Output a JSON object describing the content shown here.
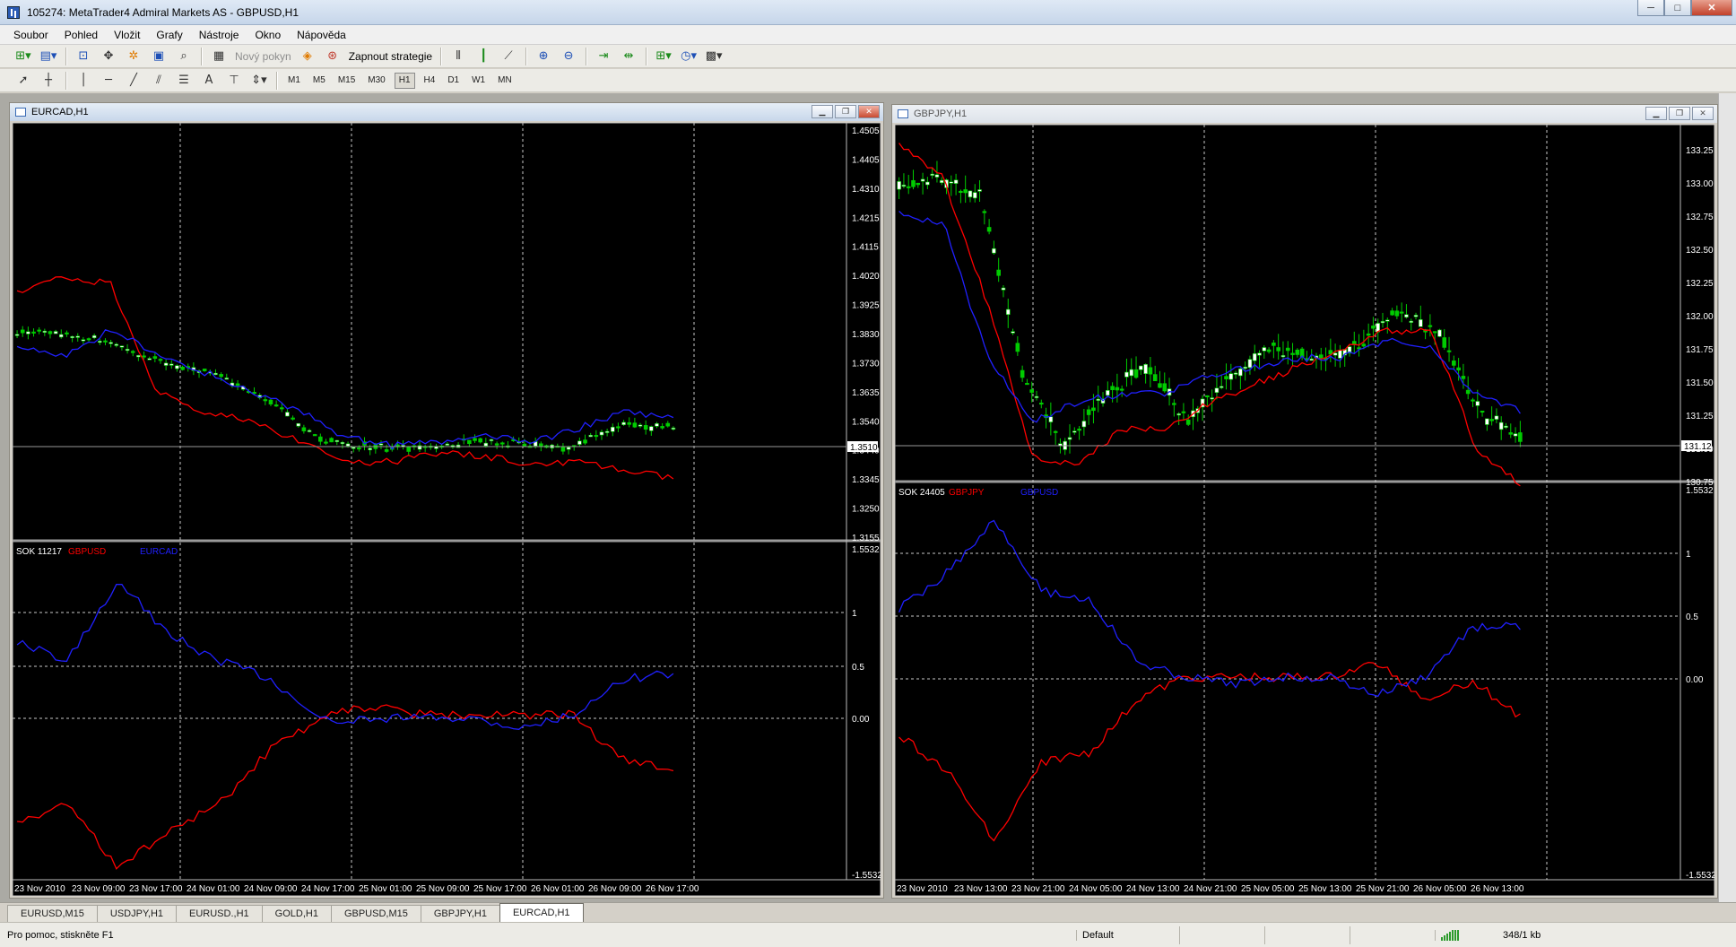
{
  "window": {
    "title": "105274: MetaTrader4 Admiral Markets AS - GBPUSD,H1",
    "buttons": [
      "─",
      "□",
      "✕"
    ]
  },
  "menu": [
    "Soubor",
    "Pohled",
    "Vložit",
    "Grafy",
    "Nástroje",
    "Okno",
    "Nápověda"
  ],
  "toolbar1": {
    "new_order": "Nový pokyn",
    "strategy": "Zapnout strategie"
  },
  "toolbar2": {
    "timeframes": [
      "M1",
      "M5",
      "M15",
      "M30",
      "H1",
      "H4",
      "D1",
      "W1",
      "MN"
    ],
    "active_timeframe": "H1"
  },
  "colors": {
    "background": "#000000",
    "grid": "#c8c8c8",
    "bull_candle": "#00cc00",
    "bear_candle": "#ffffff",
    "line_red": "#ff0000",
    "line_blue": "#2020ff",
    "text": "#ffffff"
  },
  "charts": [
    {
      "title": "EURCAD,H1",
      "price_axis": [
        "1.4505",
        "1.4405",
        "1.4310",
        "1.4215",
        "1.4115",
        "1.4020",
        "1.3925",
        "1.3830",
        "1.3730",
        "1.3635",
        "1.3540",
        "1.3440",
        "1.3345",
        "1.3250",
        "1.3155"
      ],
      "current_price": "1.3510",
      "indicator_label": "SOK 11217",
      "indicator_legend": [
        "GBPUSD",
        "EURCAD"
      ],
      "indicator_axis": [
        "1.5532",
        "1",
        "0.5",
        "0.00",
        "-1.5532"
      ],
      "time_axis": [
        "23 Nov 2010",
        "23 Nov 09:00",
        "23 Nov 17:00",
        "24 Nov 01:00",
        "24 Nov 09:00",
        "24 Nov 17:00",
        "25 Nov 01:00",
        "25 Nov 09:00",
        "25 Nov 17:00",
        "26 Nov 01:00",
        "26 Nov 09:00",
        "26 Nov 17:00"
      ]
    },
    {
      "title": "GBPJPY,H1",
      "price_axis": [
        "133.25",
        "133.00",
        "132.75",
        "132.50",
        "132.25",
        "132.00",
        "131.75",
        "131.50",
        "131.25",
        "131.00",
        "130.75"
      ],
      "current_price": "131.12",
      "indicator_label": "SOK 24405",
      "indicator_legend": [
        "GBPJPY",
        "GBPUSD"
      ],
      "indicator_axis": [
        "1.5532",
        "1",
        "0.5",
        "0.00",
        "-1.5532"
      ],
      "time_axis": [
        "23 Nov 2010",
        "23 Nov 13:00",
        "23 Nov 21:00",
        "24 Nov 05:00",
        "24 Nov 13:00",
        "24 Nov 21:00",
        "25 Nov 05:00",
        "25 Nov 13:00",
        "25 Nov 21:00",
        "26 Nov 05:00",
        "26 Nov 13:00"
      ]
    }
  ],
  "tabs": [
    "EURUSD,M15",
    "USDJPY,H1",
    "EURUSD.,H1",
    "GOLD,H1",
    "GBPUSD,M15",
    "GBPJPY,H1",
    "EURCAD,H1"
  ],
  "active_tab": "EURCAD,H1",
  "status": {
    "help": "Pro pomoc, stiskněte F1",
    "profile": "Default",
    "traffic": "348/1 kb"
  }
}
